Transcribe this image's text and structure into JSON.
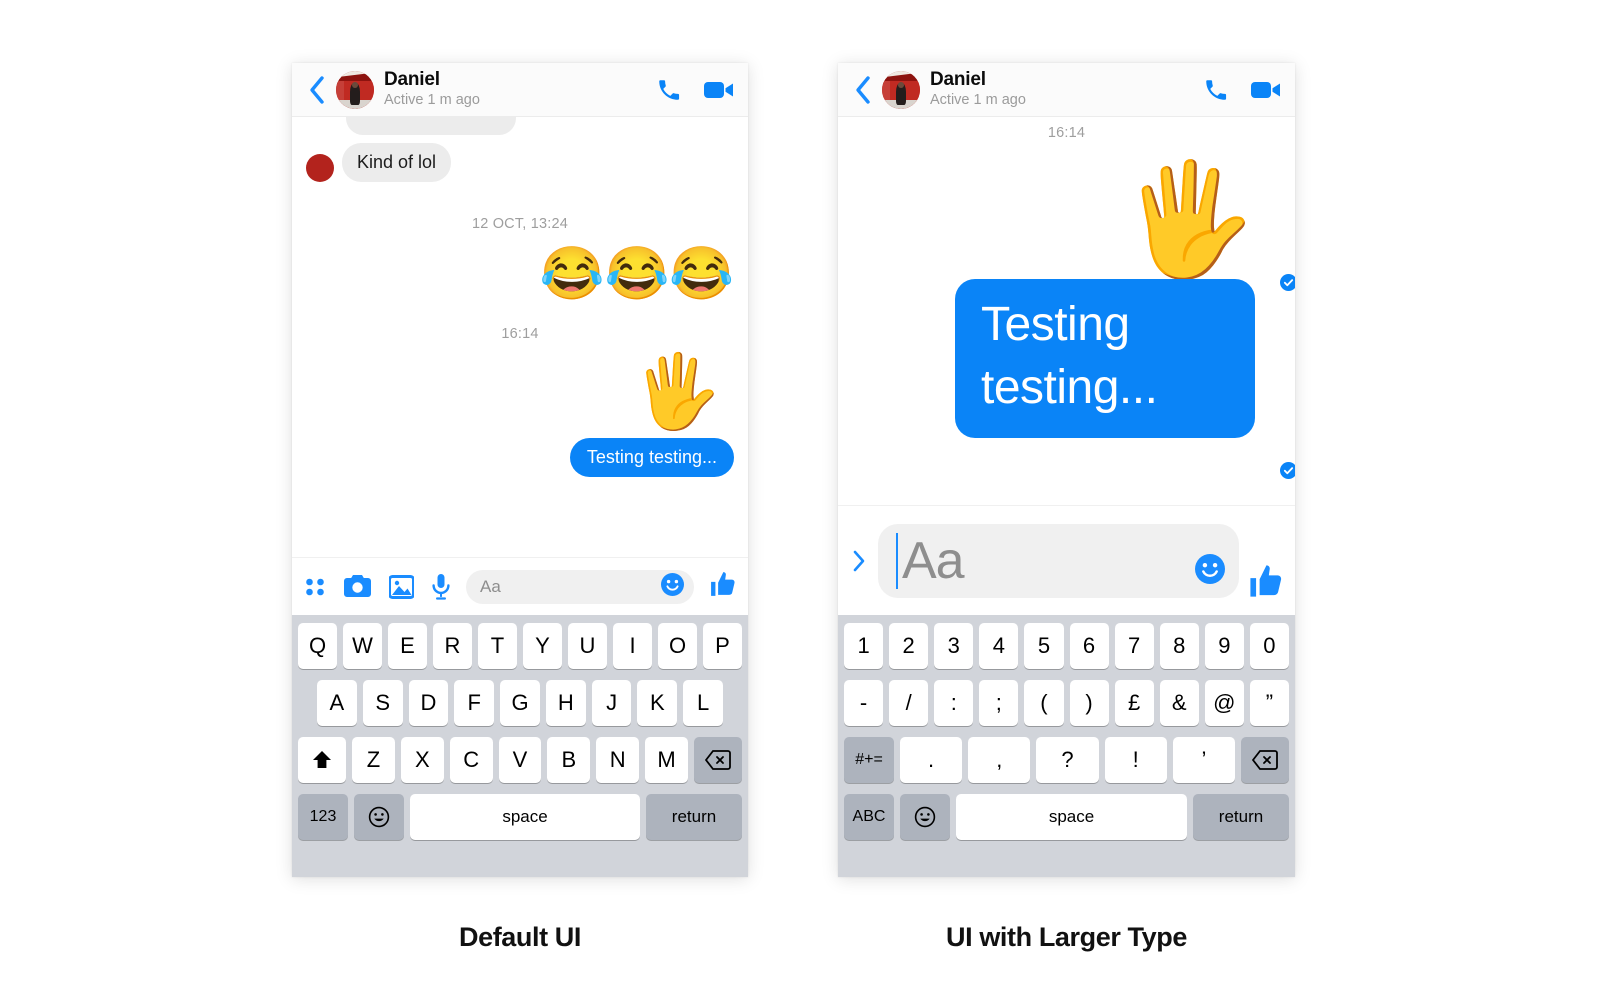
{
  "page": {
    "background": "#ffffff",
    "accent_blue": "#0a84f7",
    "bubble_gray": "#ececec",
    "keyboard_bg": "#d1d4da",
    "key_dark": "#adb3bd"
  },
  "captions": {
    "left": "Default UI",
    "right": "UI with Larger Type"
  },
  "header": {
    "name": "Daniel",
    "status": "Active 1 m ago",
    "back_icon": "back-chevron-icon",
    "call_icon": "phone-call-icon",
    "video_icon": "video-camera-icon"
  },
  "left_phone": {
    "messages": [
      {
        "type": "incoming-text",
        "text": "Kind of lol"
      },
      {
        "type": "timestamp",
        "text": "12 OCT, 13:24"
      },
      {
        "type": "outgoing-emoji",
        "text": "😂😂😂"
      },
      {
        "type": "timestamp",
        "text": "16:14"
      },
      {
        "type": "outgoing-emoji",
        "text": "🖐"
      },
      {
        "type": "outgoing-text",
        "text": "Testing testing..."
      }
    ],
    "composer": {
      "icons": [
        "four-dots-icon",
        "camera-icon",
        "photo-library-icon",
        "microphone-icon"
      ],
      "placeholder": "Aa",
      "smiley_icon": "smiley-face-icon",
      "thumb_icon": "thumbs-up-icon"
    },
    "keyboard": {
      "row1": [
        "Q",
        "W",
        "E",
        "R",
        "T",
        "Y",
        "U",
        "I",
        "O",
        "P"
      ],
      "row2": [
        "A",
        "S",
        "D",
        "F",
        "G",
        "H",
        "J",
        "K",
        "L"
      ],
      "row3_letters": [
        "Z",
        "X",
        "C",
        "V",
        "B",
        "N",
        "M"
      ],
      "shift_icon": "shift-arrow-icon",
      "delete_icon": "backspace-delete-icon",
      "mode_key": "123",
      "emoji_key": "emoji-smiley-icon",
      "space_key": "space",
      "return_key": "return"
    }
  },
  "right_phone": {
    "messages": [
      {
        "type": "timestamp",
        "text": "16:14"
      },
      {
        "type": "outgoing-emoji",
        "text": "🖐"
      },
      {
        "type": "outgoing-text",
        "text": "Testing testing..."
      }
    ],
    "status_ticks": [
      "delivered-check-icon",
      "seen-check-icon"
    ],
    "composer": {
      "expand_icon": "chevron-right-icon",
      "placeholder": "Aa",
      "smiley_icon": "smiley-face-icon",
      "thumb_icon": "thumbs-up-icon"
    },
    "keyboard": {
      "row1": [
        "1",
        "2",
        "3",
        "4",
        "5",
        "6",
        "7",
        "8",
        "9",
        "0"
      ],
      "row2": [
        "-",
        "/",
        ":",
        ";",
        "(",
        ")",
        "£",
        "&",
        "@",
        "”"
      ],
      "row3_symbols": [
        ".",
        ",",
        "?",
        "!",
        "’"
      ],
      "symbol_key": "#+=",
      "delete_icon": "backspace-delete-icon",
      "mode_key": "ABC",
      "emoji_key": "emoji-smiley-icon",
      "space_key": "space",
      "return_key": "return"
    }
  }
}
